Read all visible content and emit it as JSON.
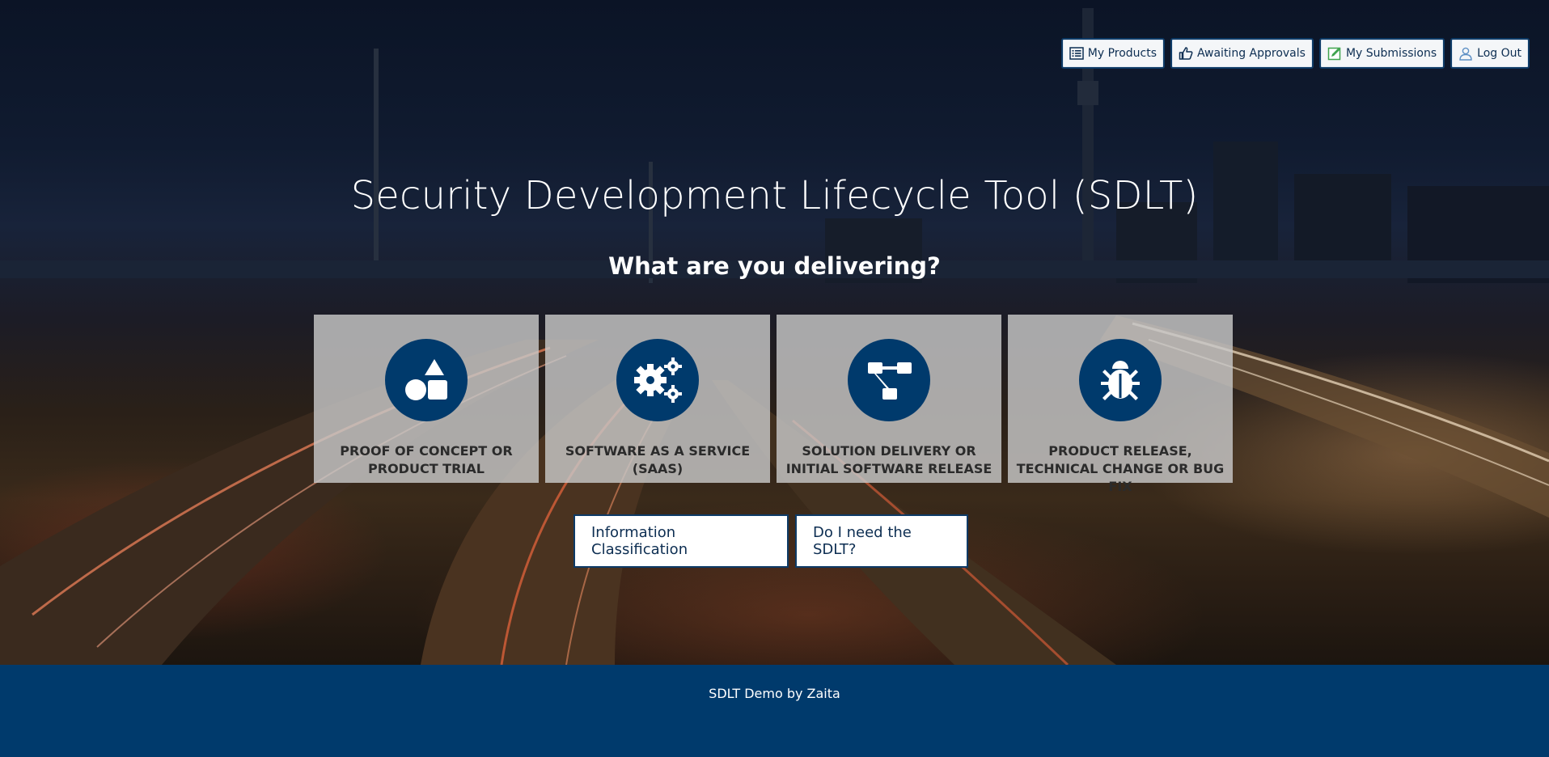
{
  "nav": {
    "my_products": "My Products",
    "awaiting_approvals": "Awaiting Approvals",
    "my_submissions": "My Submissions",
    "log_out": "Log Out"
  },
  "hero": {
    "title": "Security Development Lifecycle Tool (SDLT)",
    "subtitle": "What are you delivering?"
  },
  "cards": [
    {
      "label": "PROOF OF CONCEPT OR PRODUCT TRIAL",
      "icon": "shapes-icon"
    },
    {
      "label": "SOFTWARE AS A SERVICE (SAAS)",
      "icon": "gears-icon"
    },
    {
      "label": "SOLUTION DELIVERY OR INITIAL SOFTWARE RELEASE",
      "icon": "flowchart-icon"
    },
    {
      "label": "PRODUCT RELEASE, TECHNICAL CHANGE OR BUG FIX",
      "icon": "bug-icon"
    }
  ],
  "actions": {
    "info_classification": "Information Classification",
    "do_i_need": "Do I need the SDLT?"
  },
  "footer": {
    "text": "SDLT Demo by Zaita"
  },
  "colors": {
    "brand": "#003a6c",
    "card_bg": "#c8c8c8"
  }
}
